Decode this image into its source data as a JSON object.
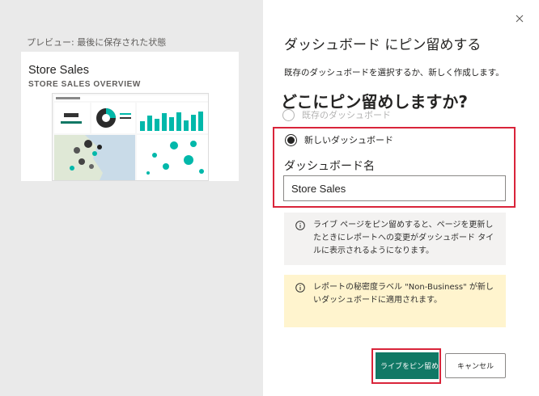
{
  "preview": {
    "label": "プレビュー: 最後に保存された状態",
    "report_title": "Store Sales",
    "report_subtitle": "STORE SALES OVERVIEW"
  },
  "dialog": {
    "title": "ダッシュボード にピン留めする",
    "description": "既存のダッシュボードを選択するか、新しく作成します。",
    "question": "どこにピン留めしますか?",
    "option_existing": "既存のダッシュボード",
    "option_new": "新しいダッシュボード",
    "selected_option": "新しいダッシュボード",
    "name_label": "ダッシュボード名",
    "name_value": "Store Sales",
    "info_text": "ライブ ページをピン留めすると、ページを更新したときにレポートへの変更がダッシュボード タイルに表示されるようになります。",
    "warning_text": "レポートの秘密度ラベル \"Non-Business\" が新しいダッシュボードに適用されます。",
    "pin_button": "ライブをピン留め",
    "cancel_button": "キャンセル"
  },
  "colors": {
    "accent": "#117865",
    "highlight": "#d9243a",
    "info_bg": "#f3f2f1",
    "warning_bg": "#fff4ce",
    "preview_bg": "#eaeaea"
  },
  "icons": {
    "close": "close-icon",
    "info": "info-icon",
    "warning": "info-icon"
  }
}
